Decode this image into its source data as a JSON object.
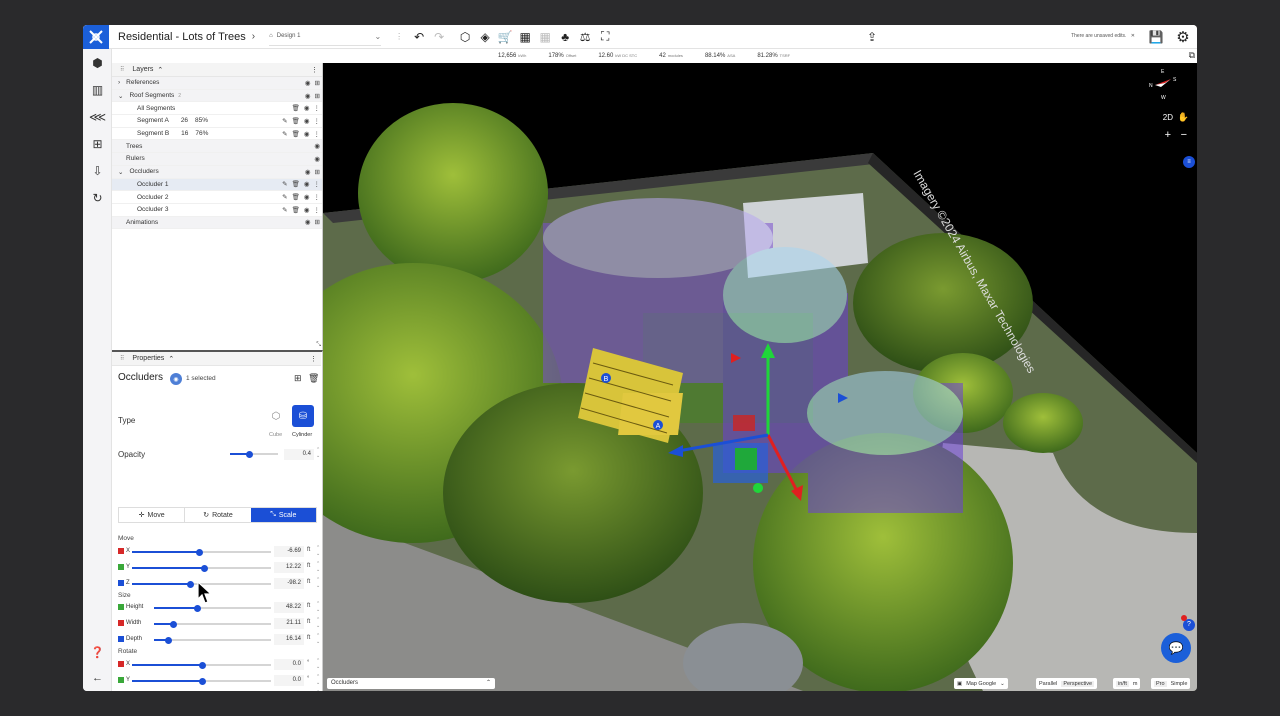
{
  "header": {
    "project_title": "Residential - Lots of Trees",
    "design_selector": "Design 1",
    "unsaved_text": "There are unsaved edits."
  },
  "stats": [
    {
      "value": "12,656",
      "unit": "kWh"
    },
    {
      "value": "178%",
      "unit": "Offset"
    },
    {
      "value": "12.60",
      "unit": "kW DC STC"
    },
    {
      "value": "42",
      "unit": "modules"
    },
    {
      "value": "88.14%",
      "unit": "ASA"
    },
    {
      "value": "81.28%",
      "unit": "TSRF"
    }
  ],
  "layers": {
    "title": "Layers",
    "rows": [
      {
        "label": "References",
        "kind": "cat",
        "indent": 0,
        "arrow": "›"
      },
      {
        "label": "Roof Segments",
        "kind": "cat",
        "indent": 0,
        "arrow": "⌄",
        "extra": "2"
      },
      {
        "label": "All Segments",
        "kind": "item",
        "indent": 1
      },
      {
        "label": "Segment A",
        "kind": "item",
        "indent": 1,
        "n": "26",
        "pct": "85%"
      },
      {
        "label": "Segment B",
        "kind": "item",
        "indent": 1,
        "n": "16",
        "pct": "76%"
      },
      {
        "label": "Trees",
        "kind": "cat",
        "indent": 0
      },
      {
        "label": "Rulers",
        "kind": "cat",
        "indent": 0
      },
      {
        "label": "Occluders",
        "kind": "cat",
        "indent": 0,
        "arrow": "⌄"
      },
      {
        "label": "Occluder 1",
        "kind": "sel",
        "indent": 1
      },
      {
        "label": "Occluder 2",
        "kind": "item",
        "indent": 1
      },
      {
        "label": "Occluder 3",
        "kind": "item",
        "indent": 1
      },
      {
        "label": "Animations",
        "kind": "cat",
        "indent": 0
      }
    ]
  },
  "properties": {
    "title": "Properties",
    "object": "Occluders",
    "selected": "1 selected",
    "type_label": "Type",
    "type_cube": "Cube",
    "type_cylinder": "Cylinder",
    "opacity_label": "Opacity",
    "opacity_value": "0.4",
    "opacity_level": 0.4,
    "modes": [
      "Move",
      "Rotate",
      "Scale"
    ],
    "move_label": "Move",
    "move": [
      {
        "axis": "X",
        "value": "-6.69",
        "unit": "ft",
        "level": 0.48,
        "color": "#d62828"
      },
      {
        "axis": "Y",
        "value": "12.22",
        "unit": "ft",
        "level": 0.52,
        "color": "#3aa83a"
      },
      {
        "axis": "Z",
        "value": "-98.2",
        "unit": "ft",
        "level": 0.42,
        "color": "#1b4fd6"
      }
    ],
    "size_label": "Size",
    "size": [
      {
        "axis": "Height",
        "value": "48.22",
        "unit": "ft",
        "level": 0.37,
        "color": "#3aa83a"
      },
      {
        "axis": "Width",
        "value": "21.11",
        "unit": "ft",
        "level": 0.16,
        "color": "#d62828"
      },
      {
        "axis": "Depth",
        "value": "16.14",
        "unit": "ft",
        "level": 0.12,
        "color": "#1b4fd6"
      }
    ],
    "rotate_label": "Rotate",
    "rotate": [
      {
        "axis": "X",
        "value": "0.0",
        "unit": "°",
        "level": 0.5,
        "color": "#d62828"
      },
      {
        "axis": "Y",
        "value": "0.0",
        "unit": "°",
        "level": 0.5,
        "color": "#3aa83a"
      },
      {
        "axis": "Z",
        "value": "0.0",
        "unit": "°",
        "level": 0.5,
        "color": "#1b4fd6"
      }
    ]
  },
  "map": {
    "compass": {
      "n": "N",
      "e": "E",
      "s": "S",
      "w": "W"
    },
    "view_2d": "2D",
    "imagery_text": "Imagery ©2024 Airbus, Maxar Technologies",
    "bottom_select": "Occluders",
    "map_provider": "Map Google",
    "parallel": "Parallel",
    "perspective": "Perspective",
    "units_in": "in/ft",
    "units_m": "m",
    "mode_pro": "Pro",
    "mode_simple": "Simple",
    "roof_labels": [
      "A",
      "B"
    ]
  }
}
